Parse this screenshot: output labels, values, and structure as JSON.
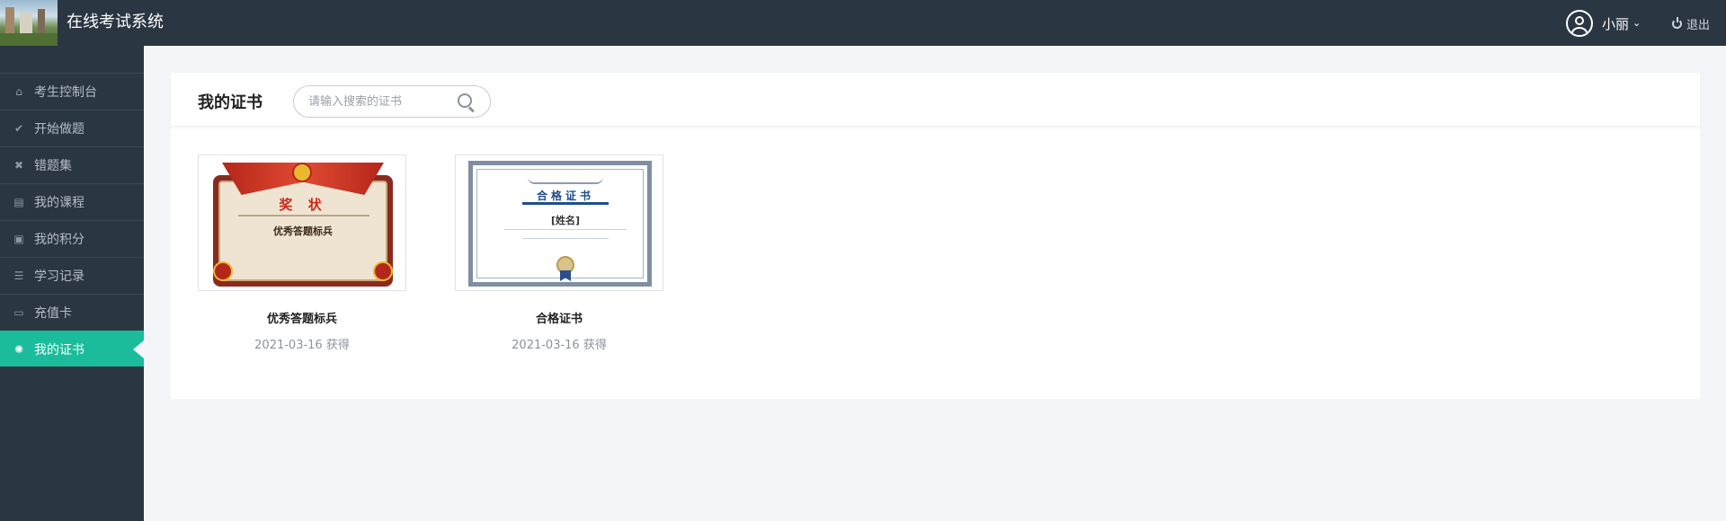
{
  "header": {
    "app_title": "在线考试系统",
    "user_name": "小丽",
    "logout_label": "退出"
  },
  "sidebar": {
    "items": [
      {
        "label": "考生控制台",
        "icon": "home-icon"
      },
      {
        "label": "开始做题",
        "icon": "check-circle-icon"
      },
      {
        "label": "错题集",
        "icon": "x-circle-icon"
      },
      {
        "label": "我的课程",
        "icon": "book-icon"
      },
      {
        "label": "我的积分",
        "icon": "gift-icon"
      },
      {
        "label": "学习记录",
        "icon": "list-icon"
      },
      {
        "label": "充值卡",
        "icon": "credit-card-icon"
      },
      {
        "label": "我的证书",
        "icon": "certificate-icon",
        "active": true
      }
    ]
  },
  "main": {
    "title": "我的证书",
    "search": {
      "placeholder": "请输入搜索的证书"
    },
    "certificates": [
      {
        "name": "优秀答题标兵",
        "date": "2021-03-16 获得",
        "thumb": {
          "heading": "奖 状",
          "subtitle": "优秀答题标兵"
        }
      },
      {
        "name": "合格证书",
        "date": "2021-03-16 获得",
        "thumb": {
          "heading": "合格证书",
          "subtitle": "[姓名]"
        }
      }
    ]
  },
  "colors": {
    "topbar": "#2b3643",
    "sidebar": "#2b3643",
    "active": "#1bbc9b",
    "background": "#f3f5f9"
  }
}
